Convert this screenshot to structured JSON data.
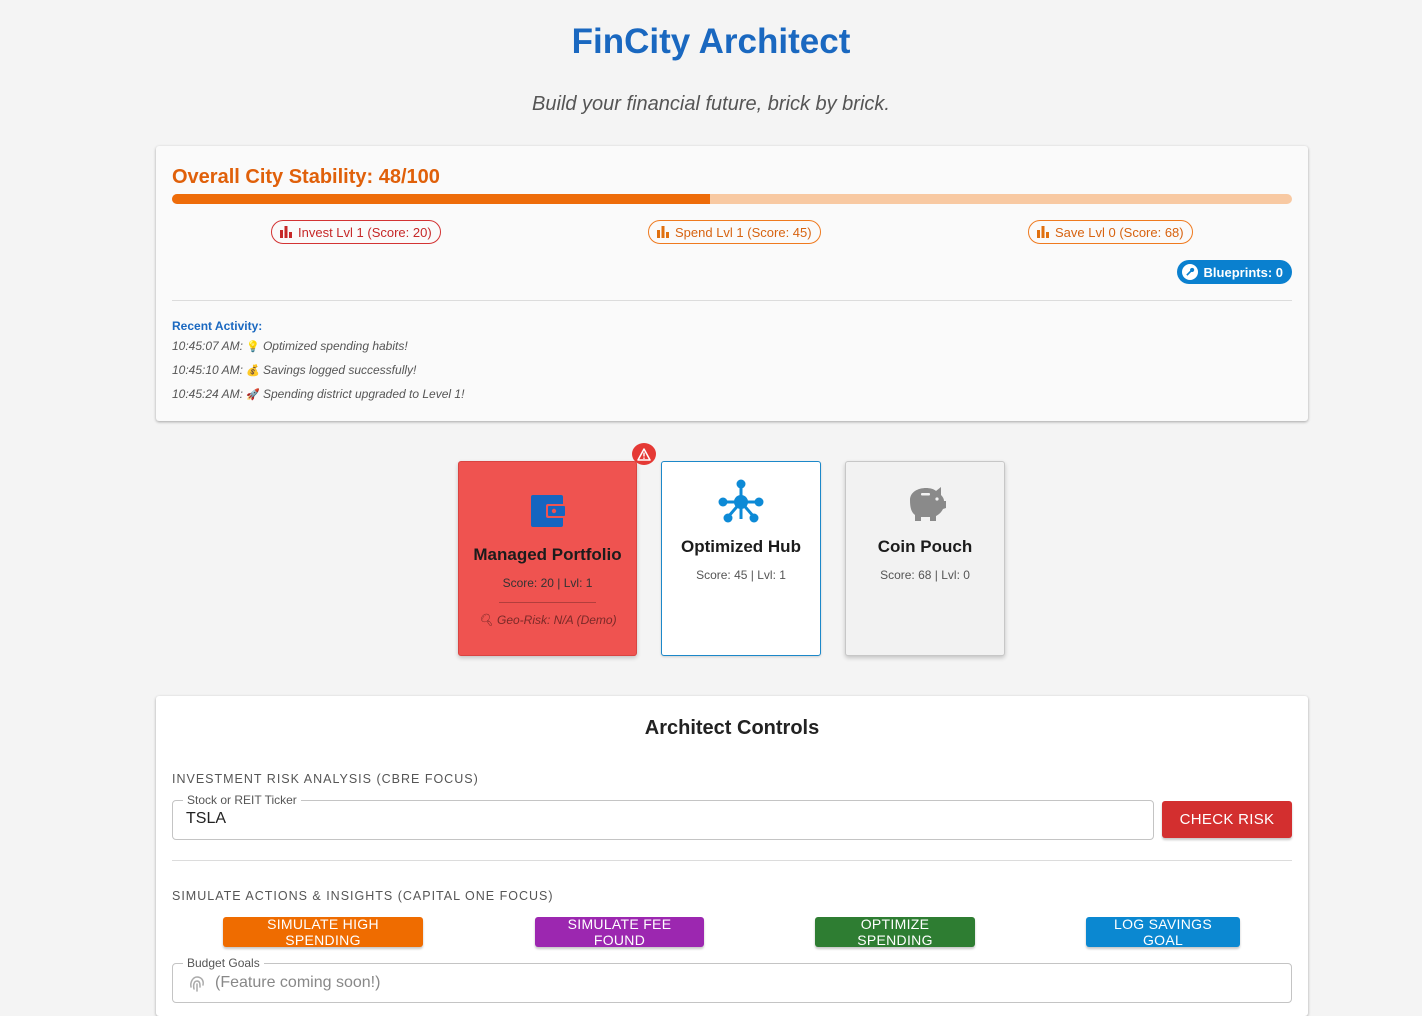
{
  "app": {
    "title": "FinCity Architect",
    "tagline": "Build your financial future, brick by brick."
  },
  "stability": {
    "label": "Overall City Stability: 48/100",
    "value": 48,
    "max": 100,
    "chips": [
      {
        "label": "Invest Lvl 1 (Score: 20)",
        "color": "#c62828"
      },
      {
        "label": "Spend Lvl 1 (Score: 45)",
        "color": "#d76310"
      },
      {
        "label": "Save Lvl 0 (Score: 68)",
        "color": "#d76310"
      }
    ],
    "blueprints_label": "Blueprints: 0"
  },
  "activity": {
    "title": "Recent Activity:",
    "items": [
      {
        "time": "10:45:07 AM:",
        "icon": "lightbulb-icon",
        "text": "Optimized spending habits!"
      },
      {
        "time": "10:45:10 AM:",
        "icon": "money-bag-icon",
        "text": "Savings logged successfully!"
      },
      {
        "time": "10:45:24 AM:",
        "icon": "rocket-icon",
        "text": "Spending district upgraded to Level 1!"
      }
    ]
  },
  "districts": [
    {
      "name": "Managed Portfolio",
      "score": "Score: 20 | Lvl: 1",
      "geo": "Geo-Risk: N/A (Demo)",
      "icon": "wallet-icon",
      "color": "#ef5350",
      "alert": true
    },
    {
      "name": "Optimized Hub",
      "score": "Score: 45 | Lvl: 1",
      "icon": "network-hub-icon",
      "color": "#ffffff"
    },
    {
      "name": "Coin Pouch",
      "score": "Score: 68 | Lvl: 0",
      "icon": "piggy-bank-icon",
      "color": "#f2f2f2"
    }
  ],
  "controls": {
    "title": "Architect Controls",
    "investment_section": "INVESTMENT RISK ANALYSIS (CBRE FOCUS)",
    "ticker_label": "Stock or REIT Ticker",
    "ticker_value": "TSLA",
    "check_risk": "CHECK RISK",
    "simulate_section": "SIMULATE ACTIONS & INSIGHTS (CAPITAL ONE FOCUS)",
    "buttons": [
      {
        "label": "SIMULATE HIGH SPENDING",
        "color": "#ef6c00"
      },
      {
        "label": "SIMULATE FEE FOUND",
        "color": "#9c27b0"
      },
      {
        "label": "OPTIMIZE SPENDING",
        "color": "#2e7d32"
      },
      {
        "label": "LOG SAVINGS GOAL",
        "color": "#0b88d1"
      }
    ],
    "budget_label": "Budget Goals",
    "budget_placeholder": "(Feature coming soon!)"
  }
}
